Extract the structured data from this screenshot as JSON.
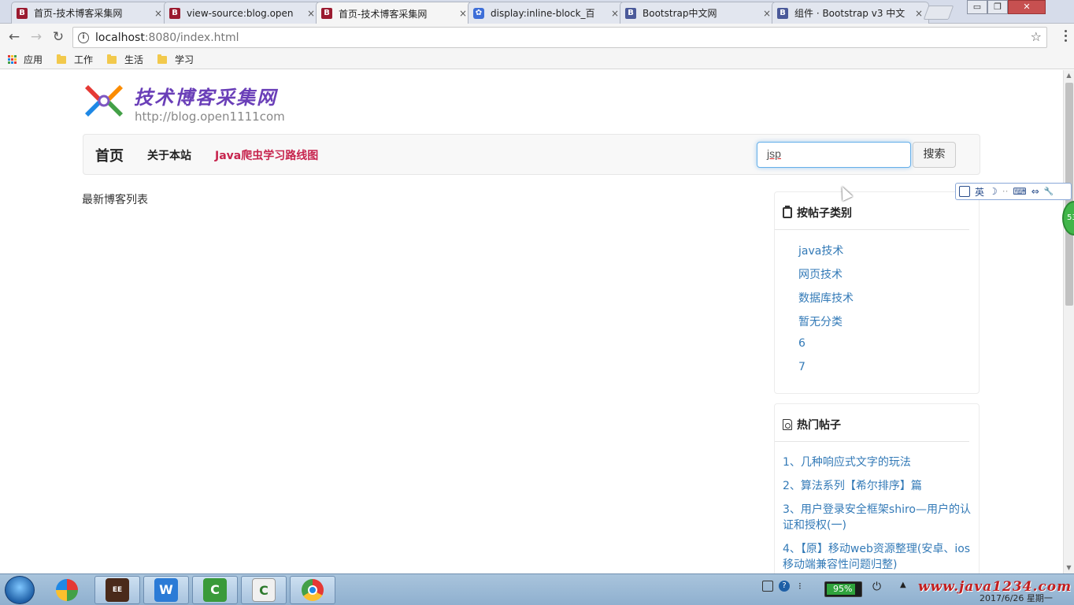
{
  "browser": {
    "tabs": [
      {
        "title": "首页-技术博客采集网",
        "favicon": "B",
        "favicon_color": "#9b1b30",
        "active": false
      },
      {
        "title": "view-source:blog.open",
        "favicon": "B",
        "favicon_color": "#9b1b30",
        "active": false
      },
      {
        "title": "首页-技术博客采集网",
        "favicon": "B",
        "favicon_color": "#9b1b30",
        "active": true
      },
      {
        "title": "display:inline-block_百",
        "favicon": "paw",
        "favicon_color": "#3d6ed8",
        "active": false
      },
      {
        "title": "Bootstrap中文网",
        "favicon": "B",
        "favicon_color": "#4b5a9a",
        "active": false
      },
      {
        "title": "组件 · Bootstrap v3 中文",
        "favicon": "B",
        "favicon_color": "#4b5a9a",
        "active": false
      }
    ],
    "close_glyph": "×",
    "window_controls": {
      "minimize": "▭",
      "restore": "❐",
      "close": "✕"
    },
    "url_host": "localhost",
    "url_rest": ":8080/index.html",
    "bookmarks": [
      {
        "label": "应用",
        "icon": "apps-grid-icon"
      },
      {
        "label": "工作",
        "icon": "folder-icon"
      },
      {
        "label": "生活",
        "icon": "folder-icon"
      },
      {
        "label": "学习",
        "icon": "folder-icon"
      }
    ]
  },
  "page": {
    "site_title": "技术博客采集网",
    "site_url": "http://blog.open1111com",
    "nav": {
      "brand": "首页",
      "links": [
        {
          "label": "关于本站",
          "highlight": false
        },
        {
          "label": "Java爬虫学习路线图",
          "highlight": true
        }
      ],
      "search_value": "jsp",
      "search_button": "搜索"
    },
    "latest_heading": "最新博客列表",
    "categories": {
      "heading": "按帖子类别",
      "items": [
        "java技术",
        "网页技术",
        "数据库技术",
        "暂无分类",
        "6",
        "7"
      ]
    },
    "hot_posts": {
      "heading": "热门帖子",
      "items": [
        "1、几种响应式文字的玩法",
        "2、算法系列【希尔排序】篇",
        "3、用户登录安全框架shiro—用户的认证和授权(一)",
        "4、【原】移动web资源整理(安卓、ios移动端兼容性问题归整)"
      ]
    }
  },
  "ime_toolbar": {
    "lang": "英",
    "moon": "☽",
    "dots": "··",
    "keyboard": "⌨",
    "arrows": "⇔",
    "tool": "🔧"
  },
  "taskbar": {
    "battery": "95%",
    "watermark": "www.java1234.com",
    "date": "2017/6/26 星期一",
    "apps": [
      "windows-icon",
      "javaee-ide-icon",
      "wps-icon",
      "camtasia-icon",
      "camtasia-recorder-icon",
      "chrome-icon"
    ]
  },
  "colors": {
    "accent_link": "#337ab7",
    "nav_highlight": "#c7254e",
    "title_purple": "#6a3fb8"
  }
}
